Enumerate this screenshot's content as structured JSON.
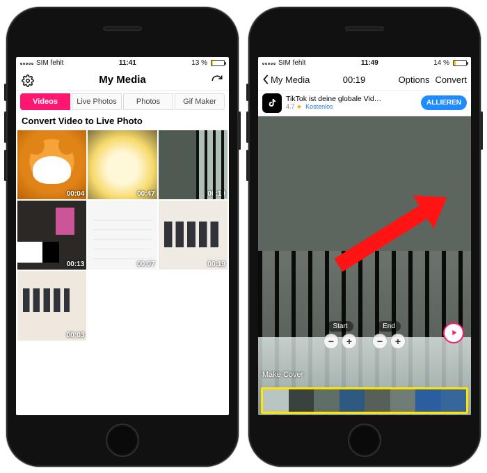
{
  "left": {
    "status": {
      "carrier": "SIM fehlt",
      "time": "11:41",
      "battery_pct": "13 %",
      "battery_fill_pct": 13
    },
    "nav": {
      "title": "My Media",
      "settings_icon": "gear-icon",
      "refresh_icon": "refresh-icon"
    },
    "tabs": [
      "Videos",
      "Live Photos",
      "Photos",
      "Gif Maker"
    ],
    "active_tab_index": 0,
    "section_title": "Convert Video to Live Photo",
    "thumbs": [
      {
        "duration": "00:04"
      },
      {
        "duration": "00:47"
      },
      {
        "duration": "00:19"
      },
      {
        "duration": "00:13"
      },
      {
        "duration": "00:07"
      },
      {
        "duration": "00:19"
      },
      {
        "duration": "00:03"
      }
    ]
  },
  "right": {
    "status": {
      "carrier": "SIM fehlt",
      "time": "11:49",
      "battery_pct": "14 %",
      "battery_fill_pct": 14
    },
    "nav": {
      "back_label": "My Media",
      "duration": "00:19",
      "options": "Options",
      "convert": "Convert"
    },
    "ad": {
      "title": "TikTok ist deine globale Vid…",
      "rating": "4.7",
      "stars": "★",
      "price": "Kostenlos",
      "button": "ALLIEREN",
      "ad_tag": "▷✕"
    },
    "trim": {
      "start_label": "Start",
      "end_label": "End",
      "minus": "−",
      "plus": "+"
    },
    "make_cover": "Make Cover"
  }
}
